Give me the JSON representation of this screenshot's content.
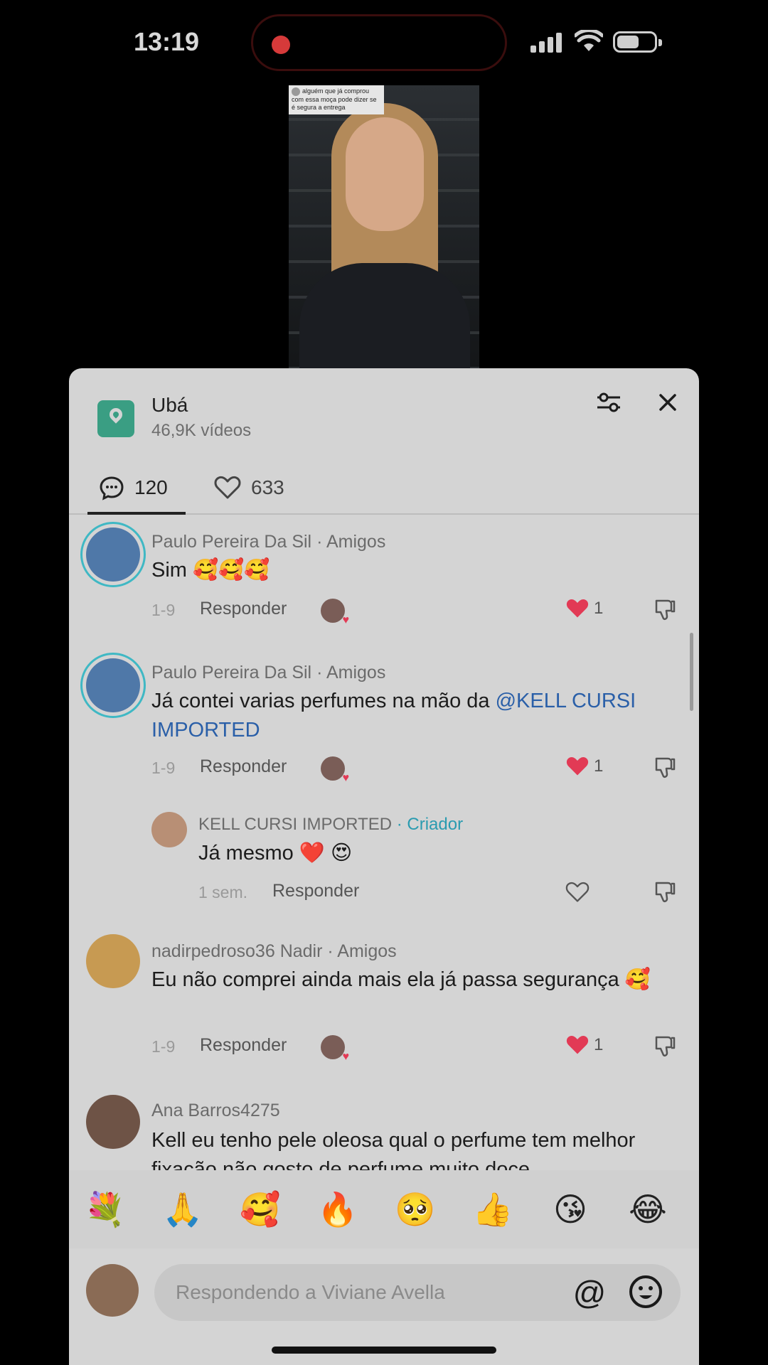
{
  "status": {
    "time": "13:19"
  },
  "video": {
    "caption": "alguém que já comprou com essa moça pode dizer se é segura a entrega"
  },
  "header": {
    "title": "Ubá",
    "subtitle": "46,9K vídeos"
  },
  "tabs": [
    {
      "label": "120",
      "icon": "comment-icon"
    },
    {
      "label": "633",
      "icon": "heart-outline-icon"
    }
  ],
  "comments": [
    {
      "name": "Paulo Pereira Da Sil",
      "tag": " · Amigos",
      "text": "Sim 🥰🥰🥰",
      "date": "1-9",
      "reply": "Responder",
      "likes": "1"
    },
    {
      "name": "Paulo Pereira Da Sil",
      "tag": " · Amigos",
      "text_before": "Já contei varias perfumes na mão da ",
      "mention": "@KELL CURSI IMPORTED",
      "date": "1-9",
      "reply": "Responder",
      "likes": "1"
    },
    {
      "name": "KELL CURSI IMPORTED",
      "tag": " · Criador",
      "text": "Já mesmo ❤️ 😍",
      "date": "1 sem.",
      "reply": "Responder"
    },
    {
      "name": "nadirpedroso36 Nadir",
      "tag": " · Amigos",
      "text": "Eu não comprei ainda mais ela já passa segurança 🥰",
      "date": "1-9",
      "reply": "Responder",
      "likes": "1"
    },
    {
      "name": "Ana Barros4275",
      "tag": "",
      "text": "Kell eu tenho pele oleosa qual o perfume tem melhor fixação não gosto de perfume muito doce"
    }
  ],
  "emojis": [
    "💐",
    "🙏",
    "🥰",
    "🔥",
    "🥺",
    "👍",
    "😘",
    "😂"
  ],
  "composer": {
    "placeholder": "Respondendo a Viviane Avella",
    "at": "@"
  },
  "colors": {
    "panel_bg": "#d4d4d4",
    "like_red": "#e23a55",
    "creator_tag": "#2a9bb0",
    "mention": "#2a5fa8",
    "location_icon": "#3a9e83",
    "story_ring": "#3fb8c4"
  }
}
